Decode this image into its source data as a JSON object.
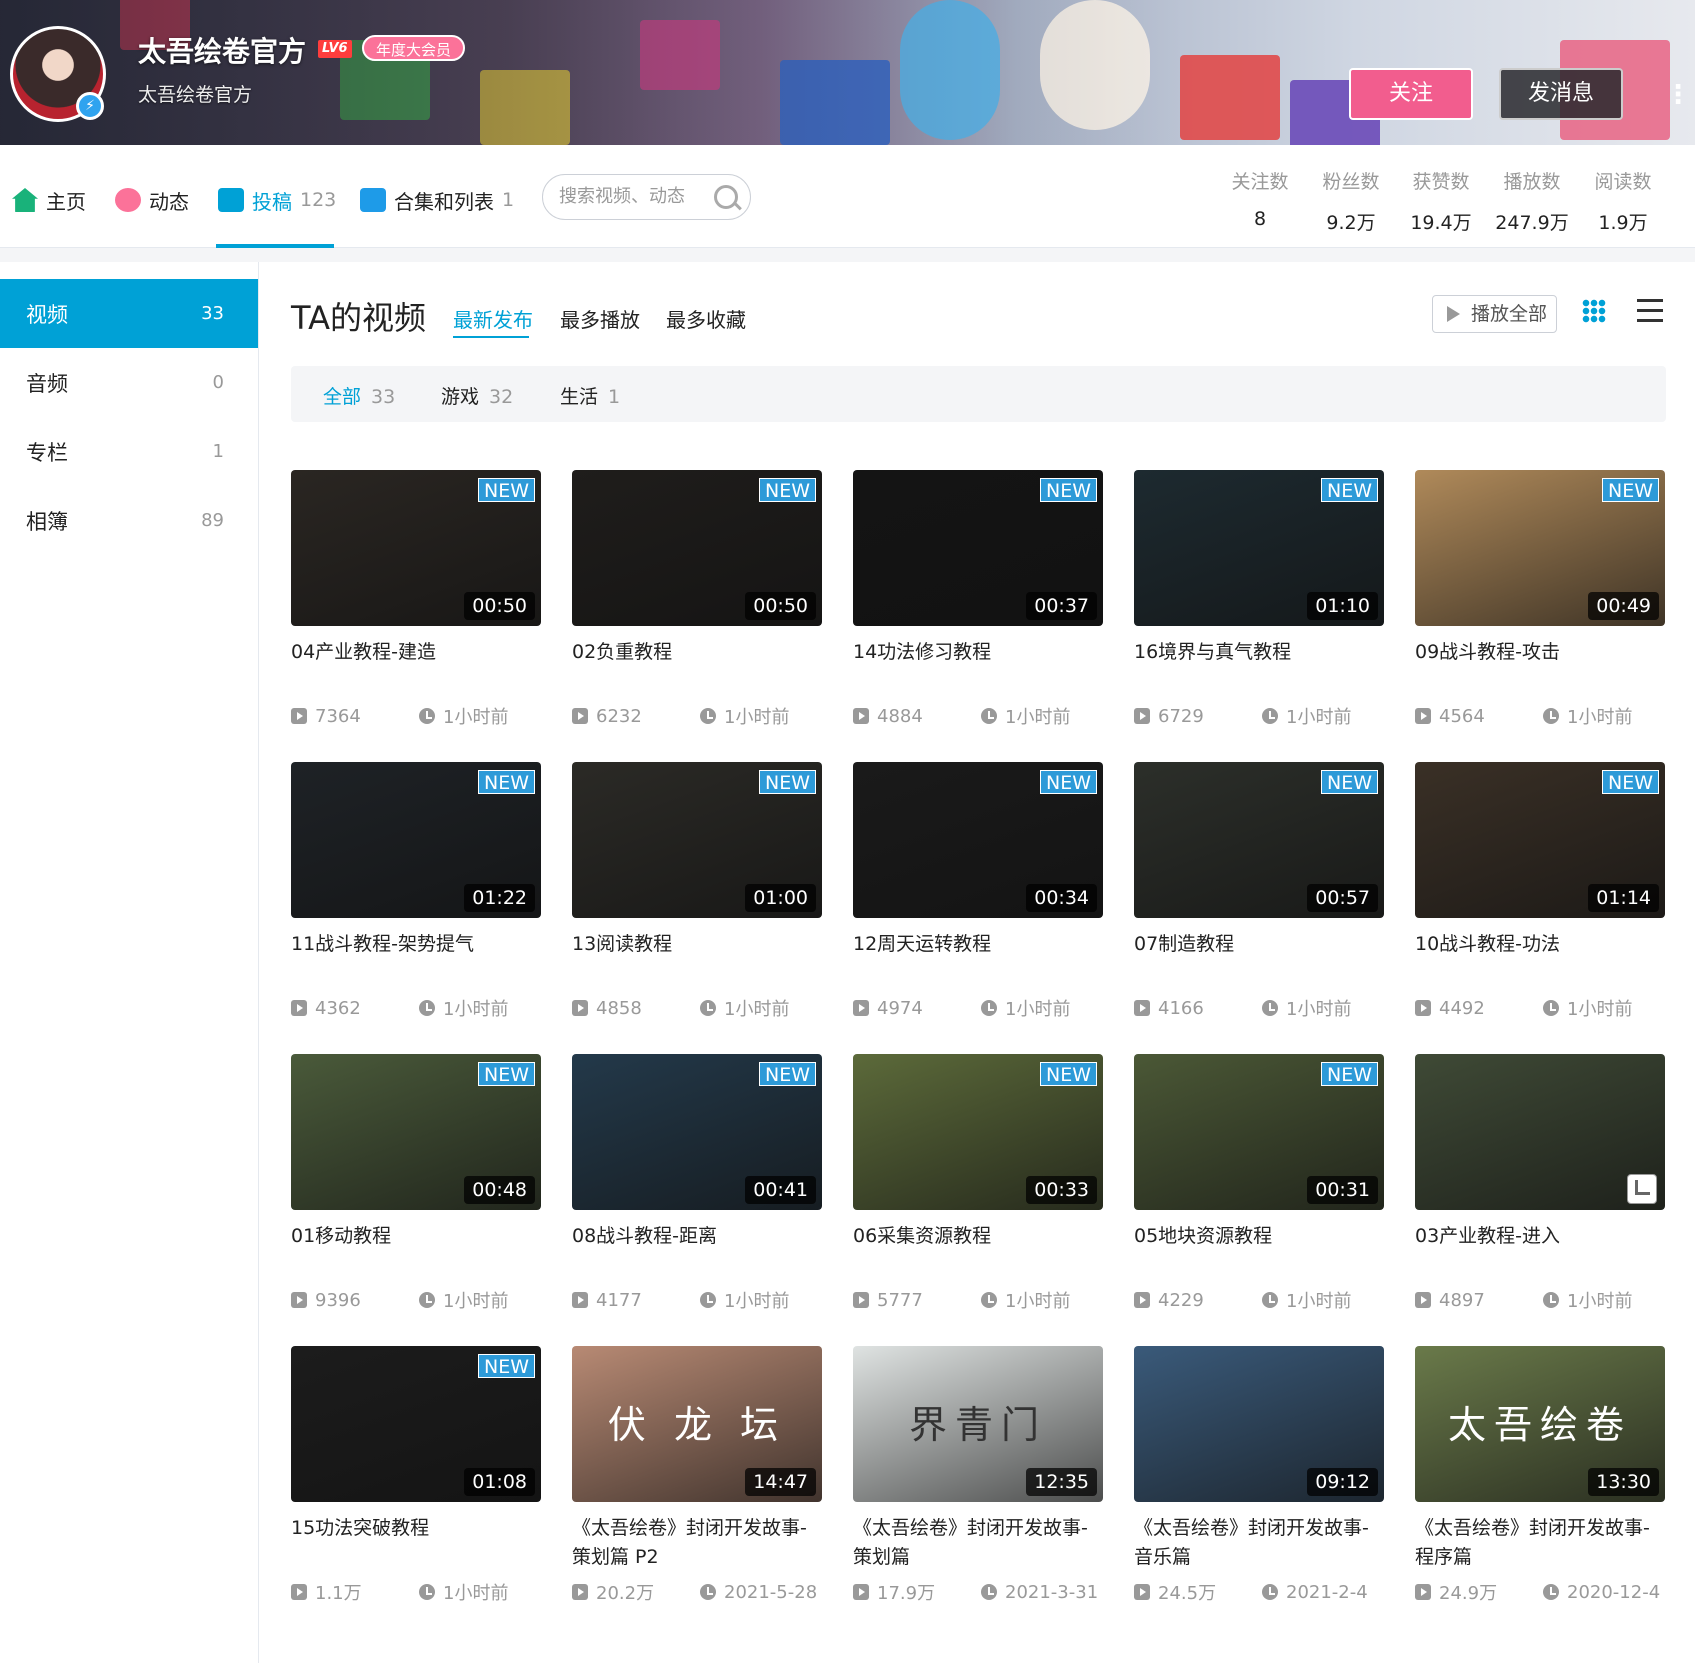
{
  "header": {
    "up_name": "太吾绘卷官方",
    "level_badge": "LV6",
    "vip_badge": "年度大会员",
    "sign": "太吾绘卷官方",
    "follow_button": "关注",
    "message_button": "发消息",
    "more_button": "⋮"
  },
  "nav": {
    "items": [
      {
        "label": "主页",
        "count": ""
      },
      {
        "label": "动态",
        "count": ""
      },
      {
        "label": "投稿",
        "count": "123"
      },
      {
        "label": "合集和列表",
        "count": "1"
      }
    ],
    "search_placeholder": "搜索视频、动态",
    "stats": [
      {
        "label": "关注数",
        "value": "8"
      },
      {
        "label": "粉丝数",
        "value": "9.2万"
      },
      {
        "label": "获赞数",
        "value": "19.4万"
      },
      {
        "label": "播放数",
        "value": "247.9万"
      },
      {
        "label": "阅读数",
        "value": "1.9万"
      }
    ]
  },
  "sidebar": {
    "items": [
      {
        "label": "视频",
        "count": "33"
      },
      {
        "label": "音频",
        "count": "0"
      },
      {
        "label": "专栏",
        "count": "1"
      },
      {
        "label": "相簿",
        "count": "89"
      }
    ]
  },
  "main": {
    "title": "TA的视频",
    "sort_tabs": [
      "最新发布",
      "最多播放",
      "最多收藏"
    ],
    "play_all": "播放全部",
    "filters": [
      {
        "label": "全部",
        "count": "33"
      },
      {
        "label": "游戏",
        "count": "32"
      },
      {
        "label": "生活",
        "count": "1"
      }
    ],
    "new_tag": "NEW"
  },
  "videos": [
    {
      "title": "04产业教程-建造",
      "duration": "00:50",
      "views": "7364",
      "time": "1小时前",
      "new": true,
      "thumb_color": "#2a2622"
    },
    {
      "title": "02负重教程",
      "duration": "00:50",
      "views": "6232",
      "time": "1小时前",
      "new": true,
      "thumb_color": "#1f1d1b"
    },
    {
      "title": "14功法修习教程",
      "duration": "00:37",
      "views": "4884",
      "time": "1小时前",
      "new": true,
      "thumb_color": "#141414"
    },
    {
      "title": "16境界与真气教程",
      "duration": "01:10",
      "views": "6729",
      "time": "1小时前",
      "new": true,
      "thumb_color": "#1d2a30"
    },
    {
      "title": "09战斗教程-攻击",
      "duration": "00:49",
      "views": "4564",
      "time": "1小时前",
      "new": true,
      "thumb_color": "#b08a5a"
    },
    {
      "title": "11战斗教程-架势提气",
      "duration": "01:22",
      "views": "4362",
      "time": "1小时前",
      "new": true,
      "thumb_color": "#1e2226"
    },
    {
      "title": "13阅读教程",
      "duration": "01:00",
      "views": "4858",
      "time": "1小时前",
      "new": true,
      "thumb_color": "#2b2a26"
    },
    {
      "title": "12周天运转教程",
      "duration": "00:34",
      "views": "4974",
      "time": "1小时前",
      "new": true,
      "thumb_color": "#1a1a1a"
    },
    {
      "title": "07制造教程",
      "duration": "00:57",
      "views": "4166",
      "time": "1小时前",
      "new": true,
      "thumb_color": "#2c2f2a"
    },
    {
      "title": "10战斗教程-功法",
      "duration": "01:14",
      "views": "4492",
      "time": "1小时前",
      "new": true,
      "thumb_color": "#3a3026"
    },
    {
      "title": "01移动教程",
      "duration": "00:48",
      "views": "9396",
      "time": "1小时前",
      "new": true,
      "thumb_color": "#4a5a3a"
    },
    {
      "title": "08战斗教程-距离",
      "duration": "00:41",
      "views": "4177",
      "time": "1小时前",
      "new": true,
      "thumb_color": "#23394a"
    },
    {
      "title": "06采集资源教程",
      "duration": "00:33",
      "views": "5777",
      "time": "1小时前",
      "new": true,
      "thumb_color": "#5c6a3a"
    },
    {
      "title": "05地块资源教程",
      "duration": "00:31",
      "views": "4229",
      "time": "1小时前",
      "new": true,
      "thumb_color": "#4b5836"
    },
    {
      "title": "03产业教程-进入",
      "duration": "",
      "views": "4897",
      "time": "1小时前",
      "new": false,
      "thumb_color": "#3f4a36"
    },
    {
      "title": "15功法突破教程",
      "duration": "01:08",
      "views": "1.1万",
      "time": "1小时前",
      "new": true,
      "thumb_color": "#1c1c1c"
    },
    {
      "title": "《太吾绘卷》封闭开发故事-策划篇 P2",
      "duration": "14:47",
      "views": "20.2万",
      "time": "2021-5-28",
      "new": false,
      "thumb_color": "#b88a74",
      "thumb_text": "伏 龙 坛"
    },
    {
      "title": "《太吾绘卷》封闭开发故事-策划篇",
      "duration": "12:35",
      "views": "17.9万",
      "time": "2021-3-31",
      "new": false,
      "thumb_color": "#dfe3e2",
      "thumb_text": "界青门"
    },
    {
      "title": "《太吾绘卷》封闭开发故事-音乐篇",
      "duration": "09:12",
      "views": "24.5万",
      "time": "2021-2-4",
      "new": false,
      "thumb_color": "#3a5a7a"
    },
    {
      "title": "《太吾绘卷》封闭开发故事-程序篇",
      "duration": "13:30",
      "views": "24.9万",
      "time": "2020-12-4",
      "new": false,
      "thumb_color": "#6a7a4a",
      "thumb_text": "太吾绘卷"
    }
  ],
  "colors": {
    "accent": "#00a1d6",
    "follow": "#f25d8e",
    "new_tag": "#2d9ad8"
  }
}
